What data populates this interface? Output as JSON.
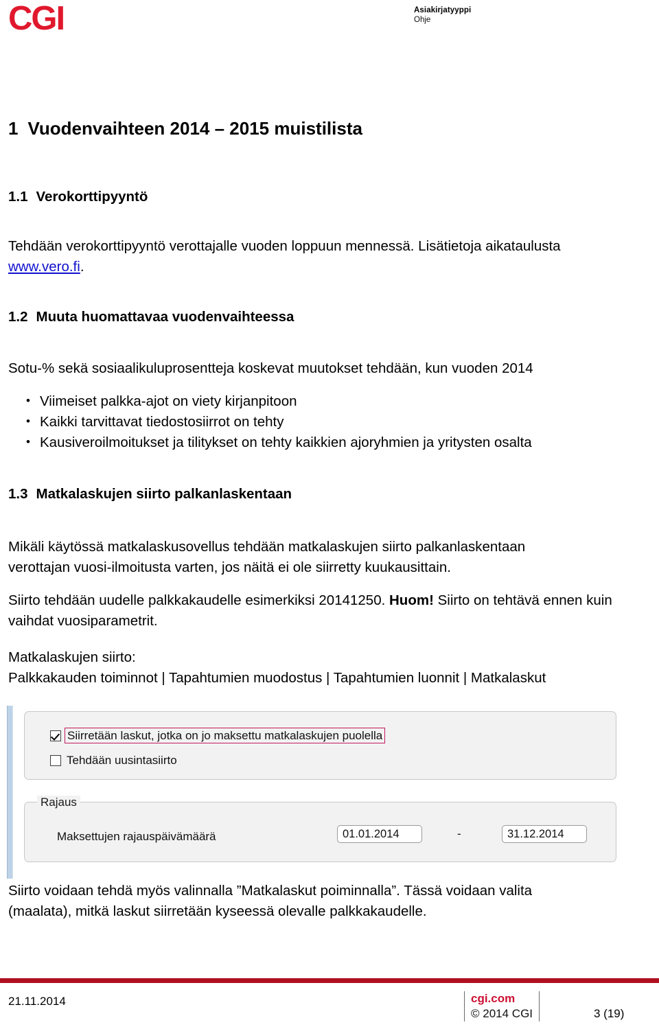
{
  "header": {
    "logo_text": "CGI",
    "logo_color": "#E0182D",
    "doc_type_label": "Asiakirjatyyppi",
    "doc_type_value": "Ohje"
  },
  "document": {
    "title_number": "1",
    "title_text": "Vuodenvaihteen 2014 – 2015  muistilista",
    "sections": [
      {
        "number": "1.1",
        "heading": "Verokorttipyyntö",
        "paragraph_before_link": "Tehdään verokorttipyyntö verottajalle vuoden loppuun mennessä. Lisätietoja aikataulusta",
        "link_text": "www.vero.fi",
        "paragraph_after_link": "."
      },
      {
        "number": "1.2",
        "heading": "Muuta huomattavaa vuodenvaihteessa",
        "intro": "Sotu-% sekä sosiaalikuluprosentteja koskevat muutokset tehdään, kun vuoden 2014",
        "bullets": [
          "Viimeiset palkka-ajot on viety kirjanpitoon",
          "Kaikki tarvittavat tiedostosiirrot on tehty",
          "Kausiveroilmoitukset ja tilitykset on tehty kaikkien ajoryhmien ja yritysten osalta"
        ]
      },
      {
        "number": "1.3",
        "heading": "Matkalaskujen siirto palkanlaskentaan",
        "paragraph1_line1": "Mikäli käytössä matkalaskusovellus tehdään matkalaskujen siirto palkanlaskentaan",
        "paragraph1_line2": "verottajan vuosi-ilmoitusta varten, jos näitä ei ole siirretty kuukausittain.",
        "paragraph2_part1": "Siirto tehdään uudelle palkkakaudelle esimerkiksi 20141250. ",
        "paragraph2_bold": "Huom!",
        "paragraph2_part2": " Siirto on tehtävä ennen kuin vaihdat vuosiparametrit.",
        "path_label": "Matkalaskujen siirto:",
        "path_value": "Palkkakauden toiminnot | Tapahtumien muodostus | Tapahtumien luonnit | Matkalaskut",
        "paragraph3_line1": "Siirto voidaan tehdä myös valinnalla ”Matkalaskut poiminnalla”. Tässä voidaan valita",
        "paragraph3_line2": "(maalata), mitkä laskut siirretään kyseessä olevalle palkkakaudelle."
      }
    ]
  },
  "app_screenshot": {
    "checkboxes": [
      {
        "label": "Siirretään laskut, jotka on jo maksettu matkalaskujen puolella",
        "checked": "true",
        "highlighted": "true"
      },
      {
        "label": "Tehdään uusintasiirto",
        "checked": "false",
        "highlighted": "false"
      }
    ],
    "highlight_color": "#C2185B",
    "rajaus_group": {
      "legend": "Rajaus",
      "field_label": "Maksettujen rajauspäivämäärä",
      "date_from": "01.01.2014",
      "date_to": "31.12.2014",
      "separator": "-"
    }
  },
  "footer": {
    "date": "21.11.2014",
    "site": "cgi.com",
    "copyright": "© 2014 CGI",
    "page": "3 (19)",
    "rule_color": "#B01020"
  }
}
